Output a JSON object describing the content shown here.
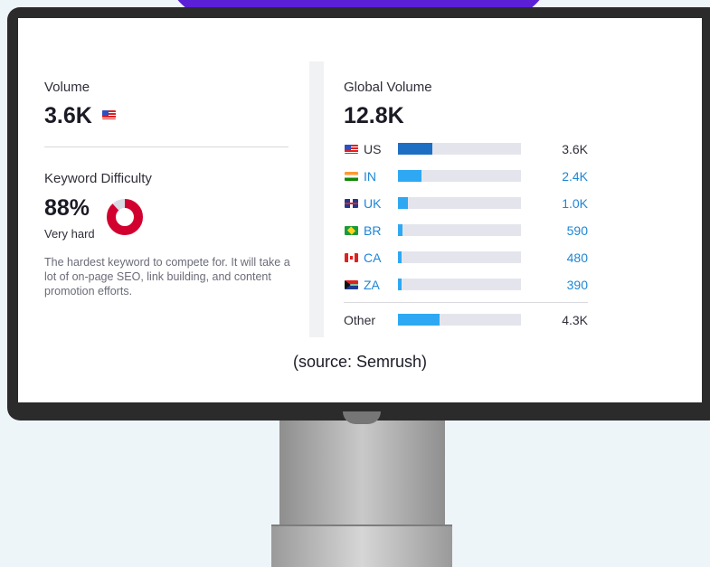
{
  "volume": {
    "label": "Volume",
    "value": "3.6K",
    "flag_icon": "us-flag-icon"
  },
  "keyword_difficulty": {
    "label": "Keyword Difficulty",
    "percent_text": "88%",
    "percent_value": 88,
    "level": "Very hard",
    "description": "The hardest keyword to compete for. It will take a lot of on-page SEO, link building, and content promotion efforts.",
    "colors": {
      "filled": "#d1002f",
      "empty": "#d9dbe4"
    }
  },
  "global_volume": {
    "label": "Global Volume",
    "value": "12.8K",
    "rows": [
      {
        "code": "US",
        "flag": "us-flag-icon",
        "value": "3.6K",
        "fill_fraction": 0.28,
        "bar_color": "#1e6fc4",
        "linked": false
      },
      {
        "code": "IN",
        "flag": "in-flag-icon",
        "value": "2.4K",
        "fill_fraction": 0.19,
        "bar_color": "#2ea8f3",
        "linked": true
      },
      {
        "code": "UK",
        "flag": "uk-flag-icon",
        "value": "1.0K",
        "fill_fraction": 0.08,
        "bar_color": "#2ea8f3",
        "linked": true
      },
      {
        "code": "BR",
        "flag": "br-flag-icon",
        "value": "590",
        "fill_fraction": 0.04,
        "bar_color": "#2ea8f3",
        "linked": true
      },
      {
        "code": "CA",
        "flag": "ca-flag-icon",
        "value": "480",
        "fill_fraction": 0.03,
        "bar_color": "#2ea8f3",
        "linked": true
      },
      {
        "code": "ZA",
        "flag": "za-flag-icon",
        "value": "390",
        "fill_fraction": 0.03,
        "bar_color": "#2ea8f3",
        "linked": true
      }
    ],
    "other": {
      "label": "Other",
      "value": "4.3K",
      "fill_fraction": 0.34,
      "bar_color": "#2ea8f3"
    }
  },
  "caption": "(source: Semrush)"
}
